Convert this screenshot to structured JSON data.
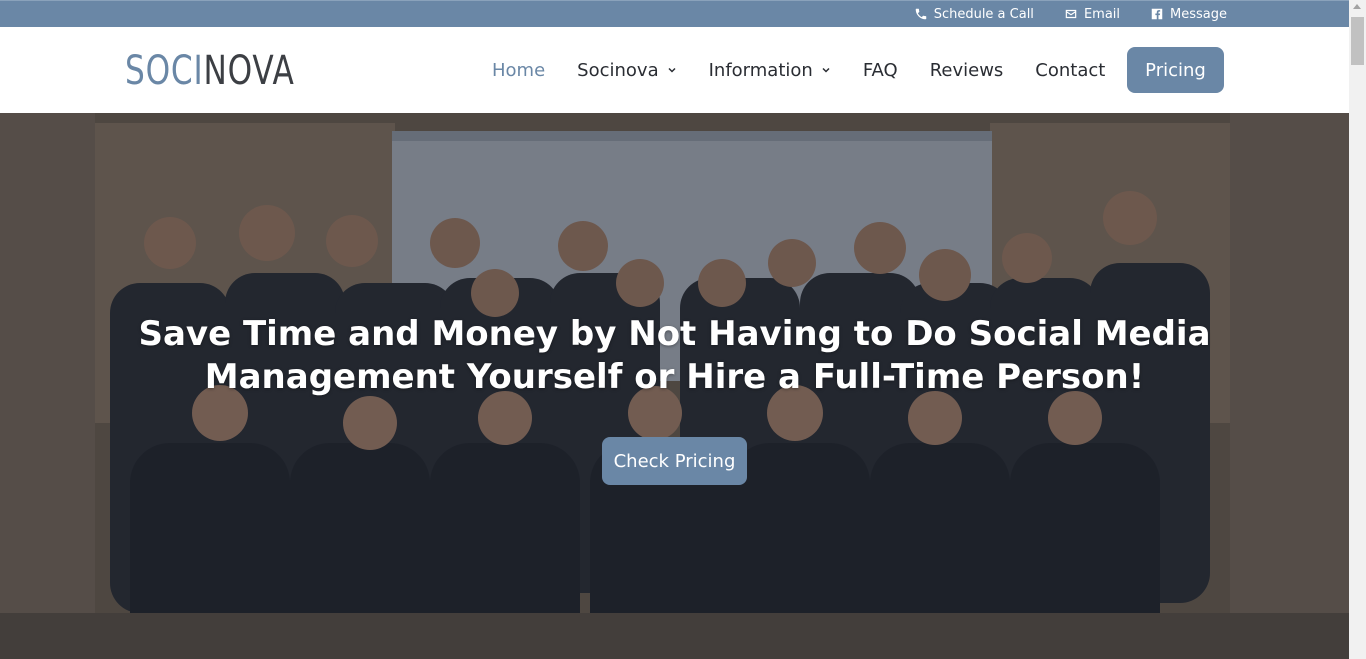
{
  "topbar": {
    "links": [
      {
        "label": "Schedule a Call",
        "icon": "phone-icon"
      },
      {
        "label": "Email",
        "icon": "envelope-icon"
      },
      {
        "label": "Message",
        "icon": "facebook-icon"
      }
    ]
  },
  "header": {
    "logo_part1": "SOCI",
    "logo_part2": "NOVA",
    "nav": [
      {
        "label": "Home",
        "active": true
      },
      {
        "label": "Socinova",
        "dropdown": true
      },
      {
        "label": "Information",
        "dropdown": true
      },
      {
        "label": "FAQ"
      },
      {
        "label": "Reviews"
      },
      {
        "label": "Contact"
      }
    ],
    "pricing_label": "Pricing"
  },
  "hero": {
    "title_line1": "Save Time and Money by Not Having to Do Social Media",
    "title_line2": "Management Yourself or Hire a Full-Time Person!",
    "cta_label": "Check Pricing"
  },
  "colors": {
    "brand": "#6a87a6",
    "text_dark": "#2a2d33"
  }
}
